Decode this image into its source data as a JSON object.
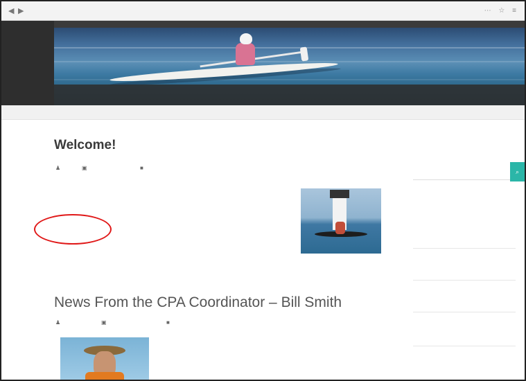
{
  "browser": {
    "back": "◀",
    "forward": "▶",
    "url_prefix": "",
    "url_domain": "",
    "menu_icons": "⋯ ☆ ≡"
  },
  "header": {
    "site_title": "",
    "menu": [
      "",
      "",
      "",
      "",
      "",
      "",
      ""
    ]
  },
  "breadcrumb": "",
  "post": {
    "title": "Welcome!",
    "meta": [
      "",
      "",
      ""
    ],
    "paragraph": "",
    "closing": ""
  },
  "news": {
    "title": "News From the CPA Coordinator – Bill Smith",
    "meta": [
      "",
      "",
      ""
    ],
    "paragraph": ""
  },
  "sidebar": {
    "search_heading": "",
    "search_placeholder": "",
    "search_button": "⌕",
    "recent_heading": "",
    "recent_posts": [
      {
        "title": "",
        "date": ""
      },
      {
        "title": "",
        "date": ""
      },
      {
        "title": "",
        "date": ""
      },
      {
        "title": "",
        "date": ""
      },
      {
        "title": "",
        "date": ""
      }
    ]
  },
  "colors": {
    "accent": "#2bb6a8",
    "link": "#4a93b8",
    "annotation": "#e01818"
  }
}
